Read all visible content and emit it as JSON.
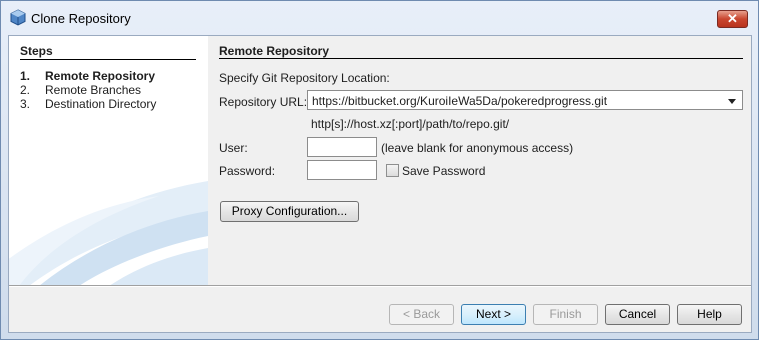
{
  "window": {
    "title": "Clone Repository",
    "close_label": "✕"
  },
  "steps": {
    "title": "Steps",
    "items": [
      {
        "num": "1.",
        "label": "Remote Repository",
        "active": true
      },
      {
        "num": "2.",
        "label": "Remote Branches",
        "active": false
      },
      {
        "num": "3.",
        "label": "Destination Directory",
        "active": false
      }
    ]
  },
  "panel": {
    "title": "Remote Repository",
    "location_label": "Specify Git Repository Location:",
    "url_label": "Repository URL:",
    "url_value": "https://bitbucket.org/KuroiIeWa5Da/pokeredprogress.git",
    "url_hint": "http[s]://host.xz[:port]/path/to/repo.git/",
    "user_label": "User:",
    "user_value": "",
    "user_hint": "(leave blank for anonymous access)",
    "password_label": "Password:",
    "password_value": "",
    "save_password_label": "Save Password",
    "save_password_checked": false,
    "proxy_button": "Proxy Configuration..."
  },
  "buttons": {
    "back": "< Back",
    "next": "Next >",
    "finish": "Finish",
    "cancel": "Cancel",
    "help": "Help"
  }
}
